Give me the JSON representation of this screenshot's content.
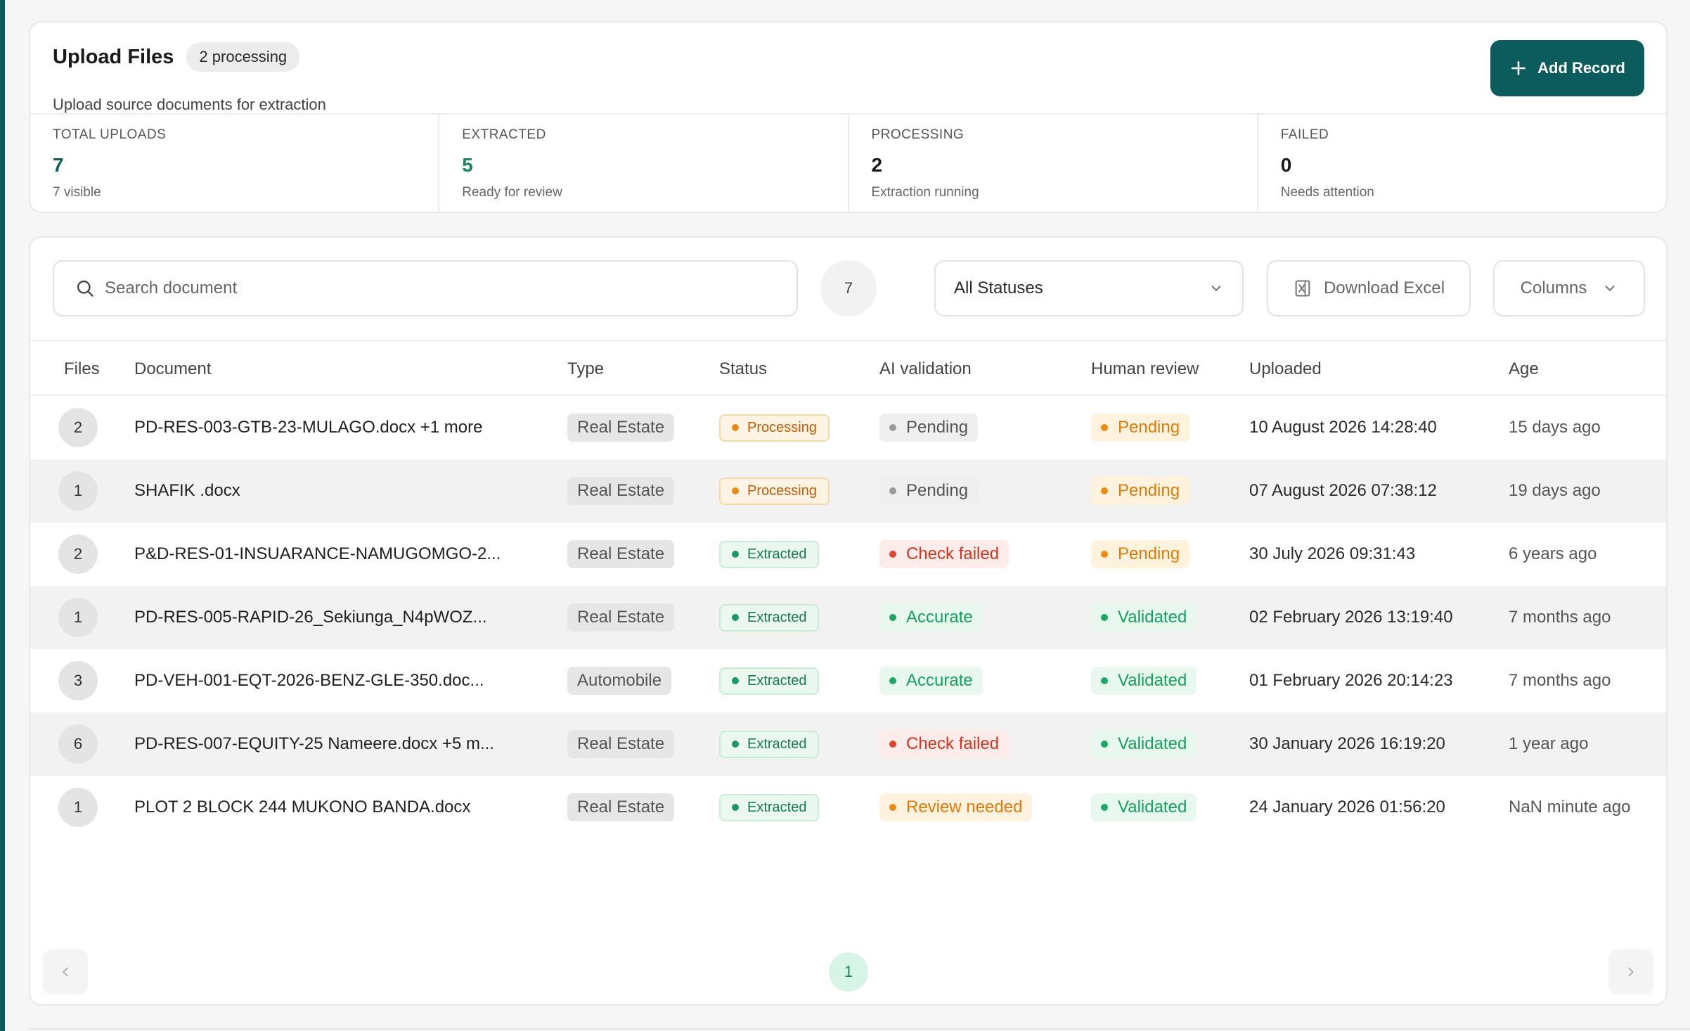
{
  "header": {
    "title": "Upload Files",
    "badge": "2 processing",
    "subtitle": "Upload source documents for extraction",
    "add_label": "Add Record"
  },
  "stats": [
    {
      "label": "TOTAL UPLOADS",
      "value": "7",
      "sub": "7 visible"
    },
    {
      "label": "EXTRACTED",
      "value": "5",
      "sub": "Ready for review"
    },
    {
      "label": "PROCESSING",
      "value": "2",
      "sub": "Extraction running"
    },
    {
      "label": "FAILED",
      "value": "0",
      "sub": "Needs attention"
    }
  ],
  "toolbar": {
    "search_placeholder": "Search document",
    "result_count": "7",
    "status_filter": "All Statuses",
    "download_label": "Download Excel",
    "columns_label": "Columns"
  },
  "columns": [
    "Files",
    "Document",
    "Type",
    "Status",
    "AI validation",
    "Human review",
    "Uploaded",
    "Age"
  ],
  "rows": [
    {
      "files": "2",
      "document": "PD-RES-003-GTB-23-MULAGO.docx +1 more",
      "type": "Real Estate",
      "status": "Processing",
      "ai": "Pending",
      "human": "Pending",
      "uploaded": "10 August 2026 14:28:40",
      "age": "15 days ago"
    },
    {
      "files": "1",
      "document": "SHAFIK .docx",
      "type": "Real Estate",
      "status": "Processing",
      "ai": "Pending",
      "human": "Pending",
      "uploaded": "07 August 2026 07:38:12",
      "age": "19 days ago"
    },
    {
      "files": "2",
      "document": "P&D-RES-01-INSUARANCE-NAMUGOMGO-2...",
      "type": "Real Estate",
      "status": "Extracted",
      "ai": "Check failed",
      "human": "Pending",
      "uploaded": "30 July 2026 09:31:43",
      "age": "6 years ago"
    },
    {
      "files": "1",
      "document": "PD-RES-005-RAPID-26_Sekiunga_N4pWOZ...",
      "type": "Real Estate",
      "status": "Extracted",
      "ai": "Accurate",
      "human": "Validated",
      "uploaded": "02 February 2026 13:19:40",
      "age": "7 months ago"
    },
    {
      "files": "3",
      "document": "PD-VEH-001-EQT-2026-BENZ-GLE-350.doc...",
      "type": "Automobile",
      "status": "Extracted",
      "ai": "Accurate",
      "human": "Validated",
      "uploaded": "01 February 2026 20:14:23",
      "age": "7 months ago"
    },
    {
      "files": "6",
      "document": "PD-RES-007-EQUITY-25 Nameere.docx +5 m...",
      "type": "Real Estate",
      "status": "Extracted",
      "ai": "Check failed",
      "human": "Validated",
      "uploaded": "30 January 2026 16:19:20",
      "age": "1 year ago"
    },
    {
      "files": "1",
      "document": "PLOT 2 BLOCK 244 MUKONO BANDA.docx",
      "type": "Real Estate",
      "status": "Extracted",
      "ai": "Review needed",
      "human": "Validated",
      "uploaded": "24 January 2026 01:56:20",
      "age": "NaN minute ago"
    }
  ],
  "pagination": {
    "current": "1"
  },
  "colors": {
    "accent": "#0c5c5d",
    "processing_bg": "#fff4e3",
    "processing_fg": "#c25a06",
    "processing_dot": "#ee8a12",
    "extracted_bg": "#eaf8f0",
    "extracted_fg": "#16794f",
    "extracted_dot": "#1a9a60",
    "pending_grey_bg": "#efefef",
    "pending_grey_fg": "#555555",
    "pending_grey_dot": "#9a9a9a",
    "pending_orange_bg": "#fff3dd",
    "pending_orange_fg": "#e07b0a",
    "pending_orange_dot": "#ee8a12",
    "failed_bg": "#fdecea",
    "failed_fg": "#d2361f",
    "failed_dot": "#e0452c",
    "accurate_bg": "#e9f8ef",
    "accurate_fg": "#16a05d",
    "accurate_dot": "#1aa863",
    "review_bg": "#fff3df",
    "review_fg": "#e07b0a",
    "review_dot": "#ee8a12"
  },
  "icons": {
    "add": "plus-icon",
    "search": "search-icon",
    "status": "chevron-down-icon",
    "download": "excel-icon",
    "columns": "chevron-down-icon",
    "prev": "chevron-left-icon",
    "next": "chevron-right-icon"
  }
}
